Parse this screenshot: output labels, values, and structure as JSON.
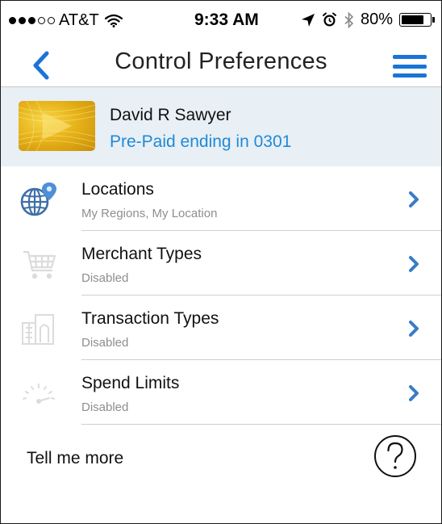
{
  "status_bar": {
    "carrier": "AT&T",
    "time": "9:33 AM",
    "battery_percent": "80%",
    "battery_level": 0.8,
    "signal_bars": 3,
    "signal_total": 5
  },
  "nav": {
    "title": "Control Preferences",
    "back_icon": "chevron-left-icon",
    "menu_icon": "hamburger-menu-icon"
  },
  "account": {
    "holder_name": "David R Sawyer",
    "card_description": "Pre-Paid ending in 0301"
  },
  "items": [
    {
      "title": "Locations",
      "subtitle": "My Regions, My Location",
      "icon": "globe-location-icon",
      "enabled": true
    },
    {
      "title": "Merchant Types",
      "subtitle": "Disabled",
      "icon": "shopping-cart-icon",
      "enabled": false
    },
    {
      "title": "Transaction Types",
      "subtitle": "Disabled",
      "icon": "store-building-icon",
      "enabled": false
    },
    {
      "title": "Spend Limits",
      "subtitle": "Disabled",
      "icon": "gauge-icon",
      "enabled": false
    }
  ],
  "tell_more": {
    "label": "Tell me more",
    "help_icon": "question-mark-icon"
  },
  "colors": {
    "accent": "#1a74d8",
    "link": "#1f8ad6",
    "chevron": "#3a7cc4",
    "account_bg": "#e8eff5",
    "subtitle": "#8e8e8e"
  }
}
